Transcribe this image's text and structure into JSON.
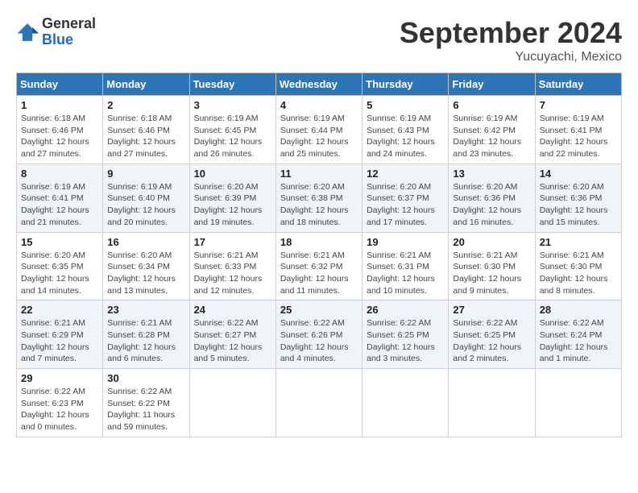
{
  "logo": {
    "general": "General",
    "blue": "Blue"
  },
  "title": "September 2024",
  "location": "Yucuyachi, Mexico",
  "days_of_week": [
    "Sunday",
    "Monday",
    "Tuesday",
    "Wednesday",
    "Thursday",
    "Friday",
    "Saturday"
  ],
  "weeks": [
    [
      {
        "day": "1",
        "sunrise": "6:18 AM",
        "sunset": "6:46 PM",
        "daylight": "12 hours and 27 minutes."
      },
      {
        "day": "2",
        "sunrise": "6:18 AM",
        "sunset": "6:46 PM",
        "daylight": "12 hours and 27 minutes."
      },
      {
        "day": "3",
        "sunrise": "6:19 AM",
        "sunset": "6:45 PM",
        "daylight": "12 hours and 26 minutes."
      },
      {
        "day": "4",
        "sunrise": "6:19 AM",
        "sunset": "6:44 PM",
        "daylight": "12 hours and 25 minutes."
      },
      {
        "day": "5",
        "sunrise": "6:19 AM",
        "sunset": "6:43 PM",
        "daylight": "12 hours and 24 minutes."
      },
      {
        "day": "6",
        "sunrise": "6:19 AM",
        "sunset": "6:42 PM",
        "daylight": "12 hours and 23 minutes."
      },
      {
        "day": "7",
        "sunrise": "6:19 AM",
        "sunset": "6:41 PM",
        "daylight": "12 hours and 22 minutes."
      }
    ],
    [
      {
        "day": "8",
        "sunrise": "6:19 AM",
        "sunset": "6:41 PM",
        "daylight": "12 hours and 21 minutes."
      },
      {
        "day": "9",
        "sunrise": "6:19 AM",
        "sunset": "6:40 PM",
        "daylight": "12 hours and 20 minutes."
      },
      {
        "day": "10",
        "sunrise": "6:20 AM",
        "sunset": "6:39 PM",
        "daylight": "12 hours and 19 minutes."
      },
      {
        "day": "11",
        "sunrise": "6:20 AM",
        "sunset": "6:38 PM",
        "daylight": "12 hours and 18 minutes."
      },
      {
        "day": "12",
        "sunrise": "6:20 AM",
        "sunset": "6:37 PM",
        "daylight": "12 hours and 17 minutes."
      },
      {
        "day": "13",
        "sunrise": "6:20 AM",
        "sunset": "6:36 PM",
        "daylight": "12 hours and 16 minutes."
      },
      {
        "day": "14",
        "sunrise": "6:20 AM",
        "sunset": "6:36 PM",
        "daylight": "12 hours and 15 minutes."
      }
    ],
    [
      {
        "day": "15",
        "sunrise": "6:20 AM",
        "sunset": "6:35 PM",
        "daylight": "12 hours and 14 minutes."
      },
      {
        "day": "16",
        "sunrise": "6:20 AM",
        "sunset": "6:34 PM",
        "daylight": "12 hours and 13 minutes."
      },
      {
        "day": "17",
        "sunrise": "6:21 AM",
        "sunset": "6:33 PM",
        "daylight": "12 hours and 12 minutes."
      },
      {
        "day": "18",
        "sunrise": "6:21 AM",
        "sunset": "6:32 PM",
        "daylight": "12 hours and 11 minutes."
      },
      {
        "day": "19",
        "sunrise": "6:21 AM",
        "sunset": "6:31 PM",
        "daylight": "12 hours and 10 minutes."
      },
      {
        "day": "20",
        "sunrise": "6:21 AM",
        "sunset": "6:30 PM",
        "daylight": "12 hours and 9 minutes."
      },
      {
        "day": "21",
        "sunrise": "6:21 AM",
        "sunset": "6:30 PM",
        "daylight": "12 hours and 8 minutes."
      }
    ],
    [
      {
        "day": "22",
        "sunrise": "6:21 AM",
        "sunset": "6:29 PM",
        "daylight": "12 hours and 7 minutes."
      },
      {
        "day": "23",
        "sunrise": "6:21 AM",
        "sunset": "6:28 PM",
        "daylight": "12 hours and 6 minutes."
      },
      {
        "day": "24",
        "sunrise": "6:22 AM",
        "sunset": "6:27 PM",
        "daylight": "12 hours and 5 minutes."
      },
      {
        "day": "25",
        "sunrise": "6:22 AM",
        "sunset": "6:26 PM",
        "daylight": "12 hours and 4 minutes."
      },
      {
        "day": "26",
        "sunrise": "6:22 AM",
        "sunset": "6:25 PM",
        "daylight": "12 hours and 3 minutes."
      },
      {
        "day": "27",
        "sunrise": "6:22 AM",
        "sunset": "6:25 PM",
        "daylight": "12 hours and 2 minutes."
      },
      {
        "day": "28",
        "sunrise": "6:22 AM",
        "sunset": "6:24 PM",
        "daylight": "12 hours and 1 minute."
      }
    ],
    [
      {
        "day": "29",
        "sunrise": "6:22 AM",
        "sunset": "6:23 PM",
        "daylight": "12 hours and 0 minutes."
      },
      {
        "day": "30",
        "sunrise": "6:22 AM",
        "sunset": "6:22 PM",
        "daylight": "11 hours and 59 minutes."
      },
      null,
      null,
      null,
      null,
      null
    ]
  ],
  "labels": {
    "sunrise": "Sunrise:",
    "sunset": "Sunset:",
    "daylight": "Daylight:"
  }
}
